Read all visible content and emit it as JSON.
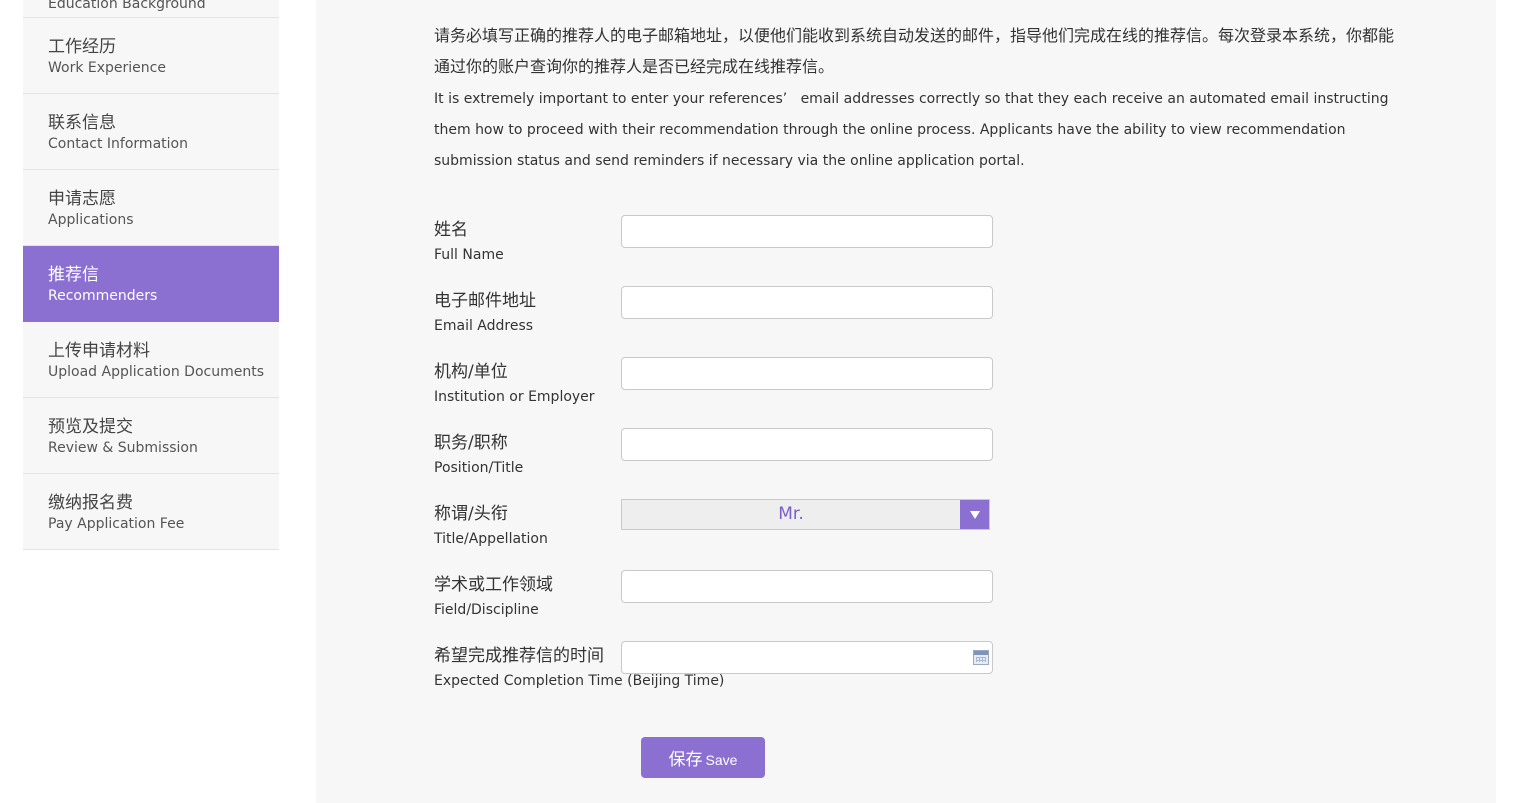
{
  "sidebar": {
    "items": [
      {
        "zh": "",
        "en": "Education Background",
        "active": false
      },
      {
        "zh": "工作经历",
        "en": "Work Experience",
        "active": false
      },
      {
        "zh": "联系信息",
        "en": "Contact Information",
        "active": false
      },
      {
        "zh": "申请志愿",
        "en": "Applications",
        "active": false
      },
      {
        "zh": "推荐信",
        "en": "Recommenders",
        "active": true
      },
      {
        "zh": "上传申请材料",
        "en": "Upload Application Documents",
        "active": false
      },
      {
        "zh": "预览及提交",
        "en": "Review & Submission",
        "active": false
      },
      {
        "zh": "缴纳报名费",
        "en": "Pay Application Fee",
        "active": false
      }
    ]
  },
  "intro": {
    "zh": "请务必填写正确的推荐人的电子邮箱地址，以便他们能收到系统自动发送的邮件，指导他们完成在线的推荐信。每次登录本系统，你都能通过你的账户查询你的推荐人是否已经完成在线推荐信。",
    "en": "It is extremely important to enter your references’   email addresses correctly so that they each receive an automated email instructing them how to proceed with their recommendation through the online process. Applicants have the ability to view recommendation submission status and send reminders if necessary via the online application portal."
  },
  "form": {
    "full_name": {
      "zh": "姓名",
      "en": "Full Name",
      "value": ""
    },
    "email": {
      "zh": "电子邮件地址",
      "en": "Email Address",
      "value": ""
    },
    "institution": {
      "zh": "机构/单位",
      "en": "Institution or Employer",
      "value": ""
    },
    "position": {
      "zh": "职务/职称",
      "en": "Position/Title",
      "value": ""
    },
    "appellation": {
      "zh": "称谓/头衔",
      "en": "Title/Appellation",
      "selected": "Mr."
    },
    "field": {
      "zh": "学术或工作领域",
      "en": "Field/Discipline",
      "value": ""
    },
    "completion_time": {
      "zh": "希望完成推荐信的时间",
      "en": "Expected Completion Time (Beijing Time)",
      "value": ""
    }
  },
  "save_button": {
    "zh": "保存",
    "en": "Save"
  },
  "colors": {
    "accent": "#8b6fd1",
    "panel_bg": "#f6f7f6"
  }
}
